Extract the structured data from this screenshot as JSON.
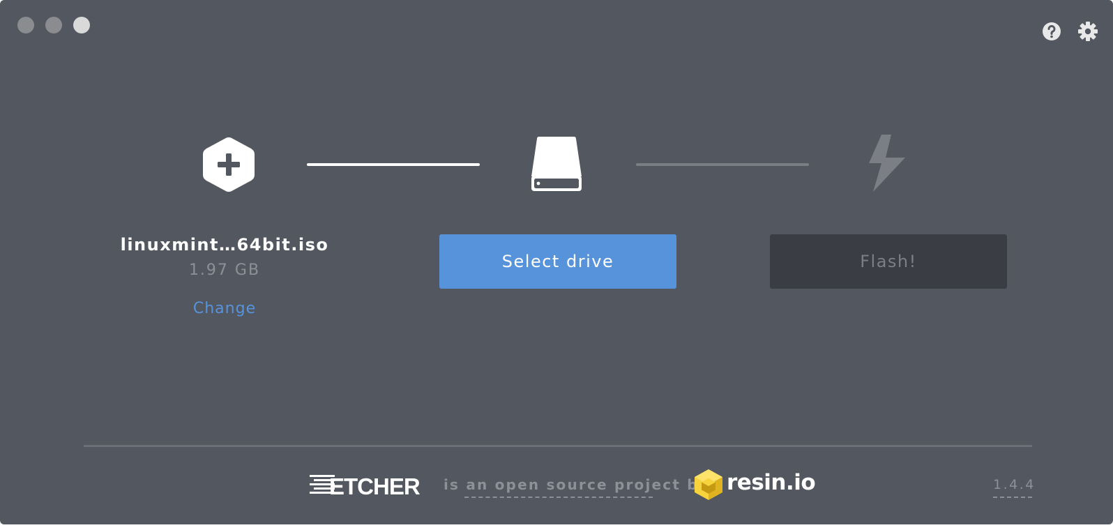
{
  "window": {
    "controls": [
      "close",
      "minimize",
      "maximize"
    ],
    "background_color": "#535760"
  },
  "toolbar": {
    "help_icon": "question-circle-icon",
    "settings_icon": "gear-icon"
  },
  "steps": {
    "image": {
      "icon": "hexagon-plus-icon",
      "filename": "linuxmint…64bit.iso",
      "size": "1.97 GB",
      "change_label": "Change"
    },
    "drive": {
      "icon": "hard-drive-icon",
      "button_label": "Select drive",
      "button_color": "#5793db"
    },
    "flash": {
      "icon": "lightning-bolt-icon",
      "button_label": "Flash!",
      "enabled": false
    }
  },
  "footer": {
    "etcher_logo": "ETCHER",
    "tagline": "is an open source project by",
    "resin_logo": "resin.io",
    "version": "1.4.4"
  }
}
